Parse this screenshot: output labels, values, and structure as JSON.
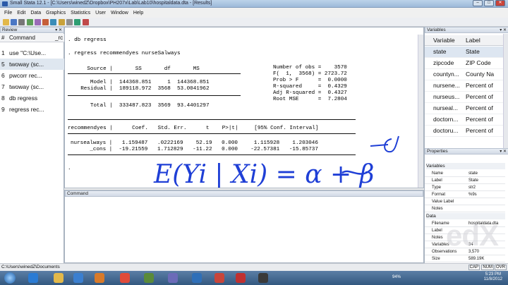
{
  "window": {
    "title": "Small Stata 12.1 - [C:\\Users\\winedZ\\Dropbox\\PH207x\\Lab\\Lab10\\hospitaldata.dta - [Results]"
  },
  "menu": [
    "File",
    "Edit",
    "Data",
    "Graphics",
    "Statistics",
    "User",
    "Window",
    "Help"
  ],
  "review": {
    "title": "Review",
    "cols": {
      "num": "#",
      "command": "Command",
      "rc": "_rc"
    },
    "items": [
      {
        "n": "1",
        "cmd": "use \"C:\\Use..."
      },
      {
        "n": "5",
        "cmd": "twoway (sc..."
      },
      {
        "n": "6",
        "cmd": "pwcorr rec..."
      },
      {
        "n": "7",
        "cmd": "twoway (sc..."
      },
      {
        "n": "8",
        "cmd": "db regress"
      },
      {
        "n": "9",
        "cmd": "regress rec..."
      }
    ]
  },
  "results": {
    "line1": ". db regress",
    "line2": ". regress recommendyes nurseSalways",
    "anova": [
      "      Source |       SS       df       MS",
      "       Model |  144368.851     1  144368.851",
      "    Residual |  189118.972  3568  53.0041962",
      "       Total |  333487.823  3569  93.4401297"
    ],
    "stats": [
      "Number of obs =    3570",
      "F(  1,  3568) = 2723.72",
      "Prob > F      =  0.0000",
      "R-squared     =  0.4329",
      "Adj R-squared =  0.4327",
      "Root MSE      =  7.2804"
    ],
    "coef_header": "recommendyes |      Coef.   Std. Err.      t    P>|t|     [95% Conf. Interval]",
    "coef_rows": [
      "nursealways |   1.159487   .0222169    52.19   0.000     1.115928    1.203046",
      "      _cons |  -19.21559   1.712829   -11.22   0.000    -22.57381   -15.85737"
    ],
    "prompt": ".",
    "handwriting": "E(Yi | Xi) = α + β"
  },
  "command": {
    "title": "Command"
  },
  "variables": {
    "title": "Variables",
    "cols": {
      "name": "Variable",
      "label": "Label"
    },
    "items": [
      {
        "name": "state",
        "label": "State"
      },
      {
        "name": "zipcode",
        "label": "ZIP Code"
      },
      {
        "name": "countyn...",
        "label": "County Na"
      },
      {
        "name": "nursene...",
        "label": "Percent of"
      },
      {
        "name": "nurseus...",
        "label": "Percent of"
      },
      {
        "name": "nurseal...",
        "label": "Percent of"
      },
      {
        "name": "doctorn...",
        "label": "Percent of"
      },
      {
        "name": "doctoru...",
        "label": "Percent of"
      }
    ]
  },
  "properties": {
    "title": "Properties",
    "variables_section": "Variables",
    "var_rows": [
      {
        "k": "Name",
        "v": "state"
      },
      {
        "k": "Label",
        "v": "State"
      },
      {
        "k": "Type",
        "v": "str2"
      },
      {
        "k": "Format",
        "v": "%9s"
      },
      {
        "k": "Value Label",
        "v": ""
      },
      {
        "k": "Notes",
        "v": ""
      }
    ],
    "data_section": "Data",
    "data_rows": [
      {
        "k": "Filename",
        "v": "hospitaldata.dta"
      },
      {
        "k": "Label",
        "v": ""
      },
      {
        "k": "Notes",
        "v": ""
      },
      {
        "k": "Variables",
        "v": "34"
      },
      {
        "k": "Observations",
        "v": "3,570"
      },
      {
        "k": "Size",
        "v": "589.19K"
      }
    ]
  },
  "status": {
    "path": "C:\\Users\\winedZ\\Documents",
    "cap": "CAP",
    "num": "NUM",
    "ovr": "OVR"
  },
  "taskbar": {
    "time": "5:23 PM",
    "date": "11/8/2012",
    "battery": "94%"
  },
  "watermark": "edX",
  "colors": {
    "accent": "#1f3fd6"
  }
}
